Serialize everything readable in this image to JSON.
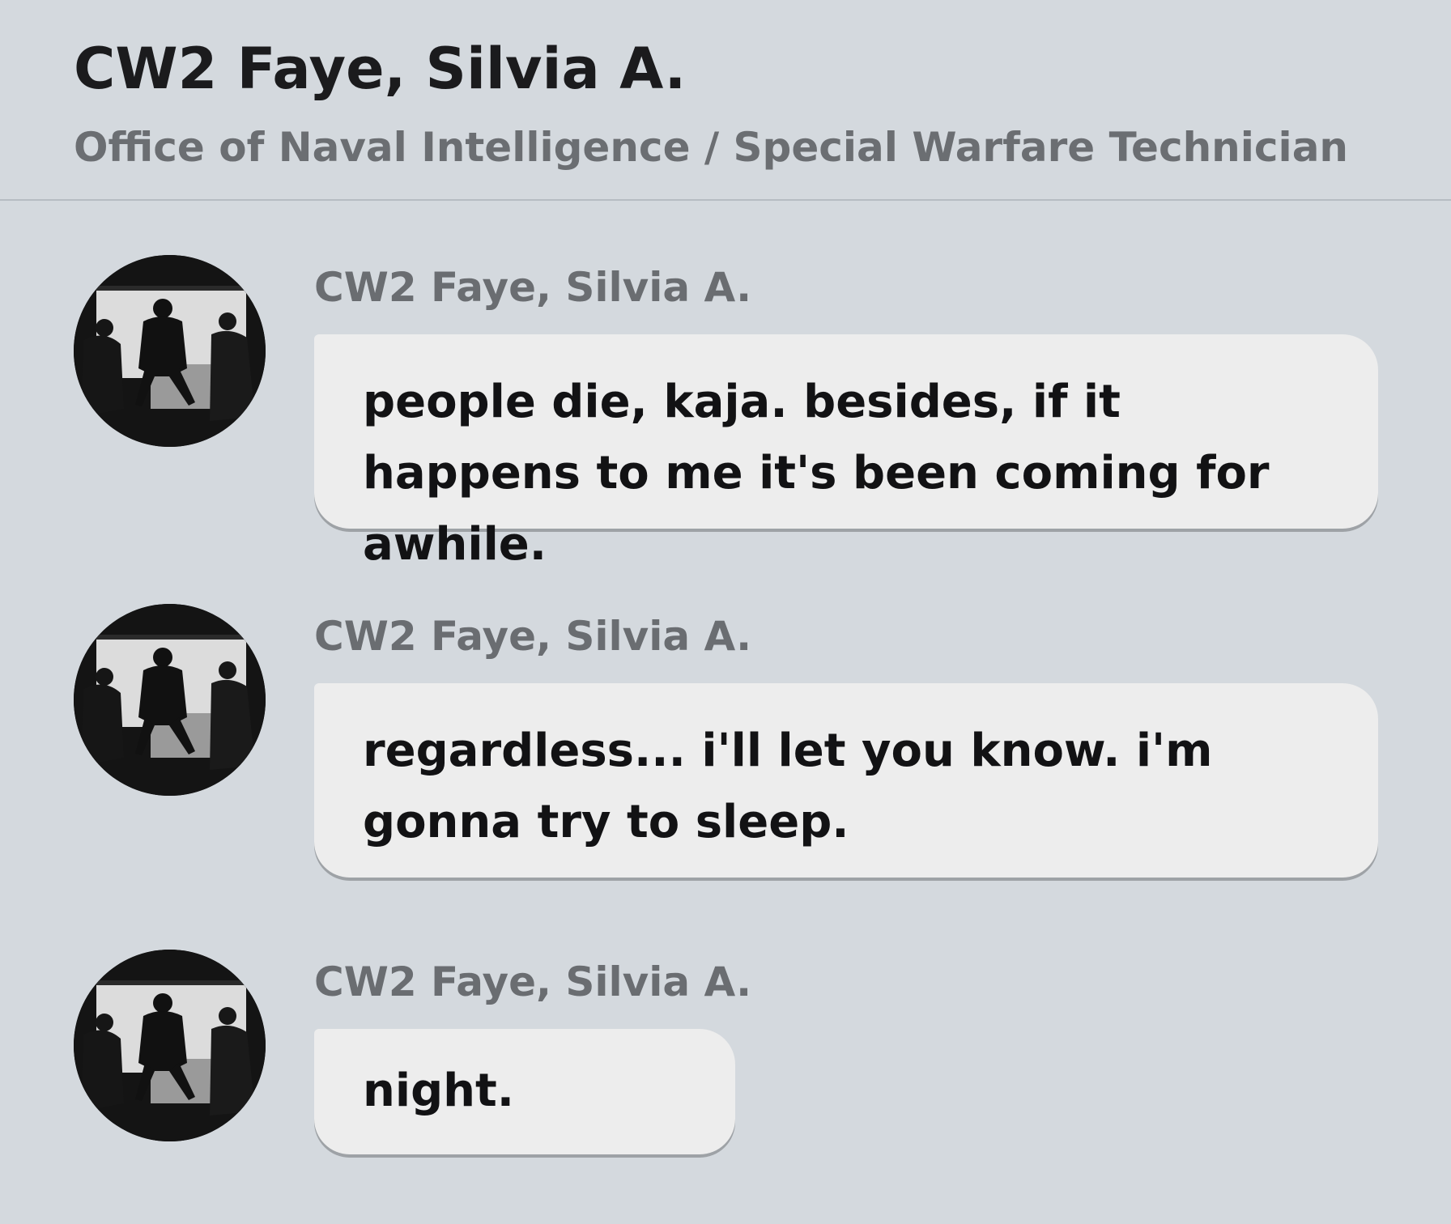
{
  "header": {
    "title": "CW2 Faye, Silvia A.",
    "subtitle": "Office of Naval Intelligence / Special Warfare Technician"
  },
  "messages": [
    {
      "sender": "CW2 Faye, Silvia A.",
      "text": "people die, kaja. besides, if it happens to me it's been coming for awhile.",
      "avatar_icon": "soldiers-silhouette-avatar"
    },
    {
      "sender": "CW2 Faye, Silvia A.",
      "text": "regardless... i'll let you know. i'm gonna try to sleep.",
      "avatar_icon": "soldiers-silhouette-avatar"
    },
    {
      "sender": "CW2 Faye, Silvia A.",
      "text": "night.",
      "avatar_icon": "soldiers-silhouette-avatar"
    }
  ],
  "colors": {
    "background": "#d4d9de",
    "bubble": "#ededed",
    "title_text": "#1b1b1d",
    "secondary_text": "#6a6d71"
  }
}
